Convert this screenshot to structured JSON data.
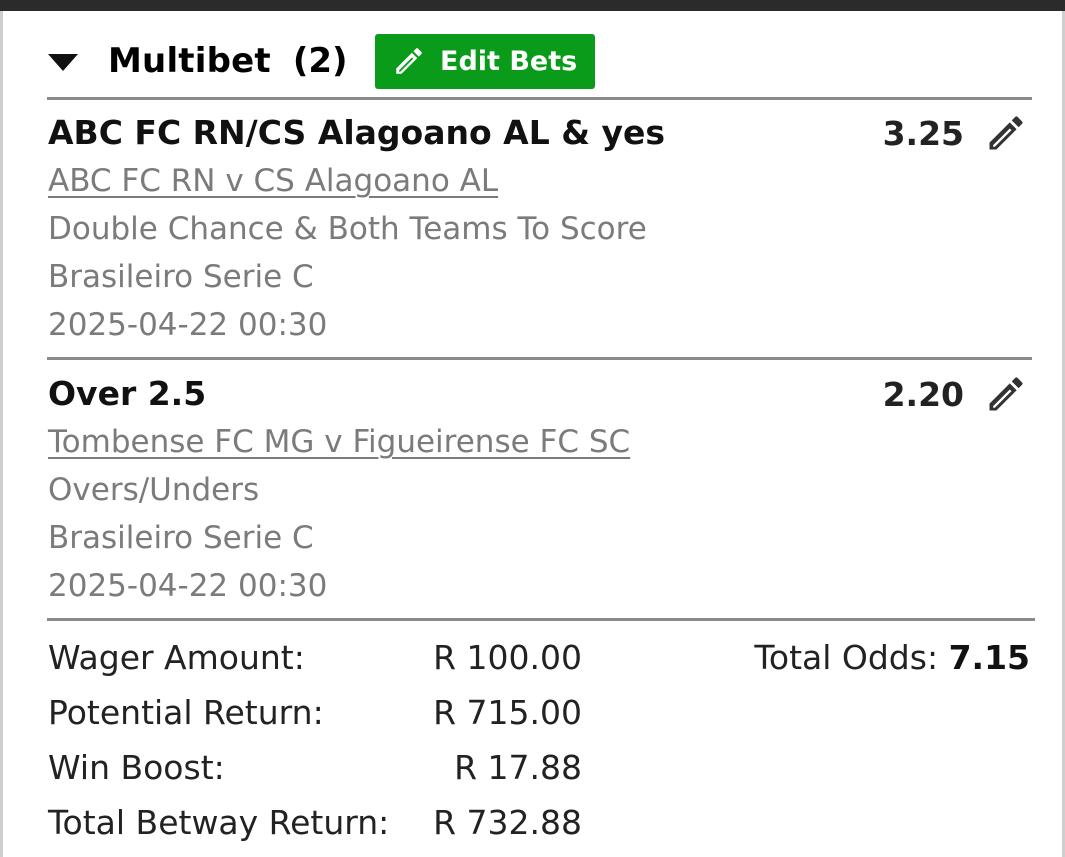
{
  "header": {
    "title": "Multibet",
    "count": "(2)",
    "edit_label": "Edit Bets"
  },
  "legs": [
    {
      "selection": "ABC FC RN/CS Alagoano AL & yes",
      "odds": "3.25",
      "match": "ABC FC RN v CS Alagoano AL",
      "market": "Double Chance & Both Teams To Score",
      "league": "Brasileiro Serie C",
      "datetime": "2025-04-22 00:30"
    },
    {
      "selection": "Over 2.5",
      "odds": "2.20",
      "match": "Tombense FC MG v Figueirense FC SC",
      "market": "Overs/Unders",
      "league": "Brasileiro Serie C",
      "datetime": "2025-04-22 00:30"
    }
  ],
  "summary": {
    "wager_label": "Wager Amount:",
    "wager_value": "R 100.00",
    "potential_label": "Potential Return:",
    "potential_value": "R 715.00",
    "boost_label": "Win Boost:",
    "boost_value": "R 17.88",
    "total_label": "Total Betway Return:",
    "total_value": "R 732.88",
    "total_odds_label": "Total Odds:",
    "total_odds_value": "7.15"
  },
  "icons": {
    "collapse": "caret-down-icon",
    "edit": "pencil-icon"
  },
  "colors": {
    "accent": "#0b9b1a",
    "muted_text": "#7b7b7b"
  }
}
